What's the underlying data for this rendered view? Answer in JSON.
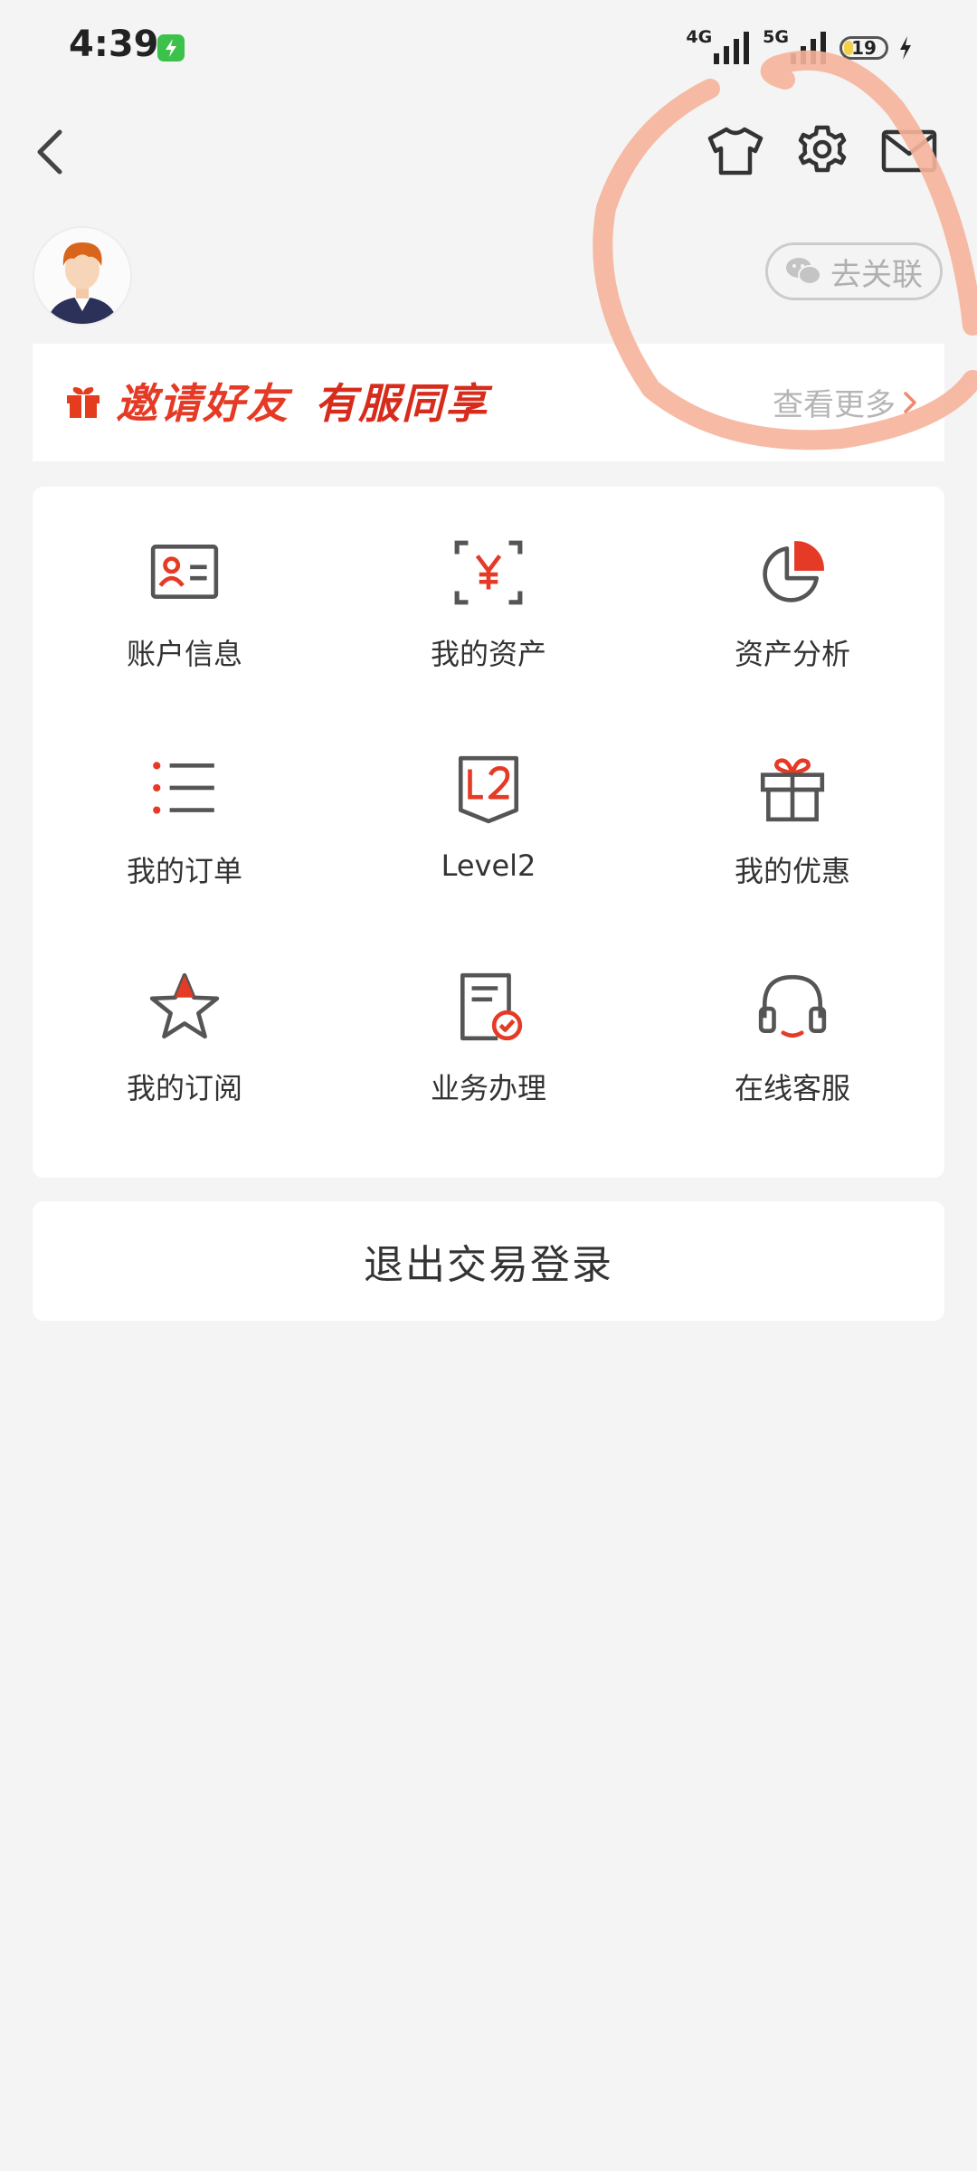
{
  "status_bar": {
    "time": "4:39",
    "network_1": "4G",
    "network_2": "5G",
    "battery": "19"
  },
  "header": {
    "back_icon": "chevron-left-icon",
    "icons": [
      "tshirt-icon",
      "gear-icon",
      "mail-icon"
    ]
  },
  "profile": {
    "wechat_link_label": "去关联"
  },
  "invite_banner": {
    "text": "邀请好友",
    "highlight": "有服同享",
    "more_label": "查看更多"
  },
  "menu": {
    "items": [
      {
        "label": "账户信息",
        "icon": "account-card-icon"
      },
      {
        "label": "我的资产",
        "icon": "yuan-scan-icon"
      },
      {
        "label": "资产分析",
        "icon": "pie-chart-icon"
      },
      {
        "label": "我的订单",
        "icon": "list-icon"
      },
      {
        "label": "Level2",
        "icon": "level2-icon"
      },
      {
        "label": "我的优惠",
        "icon": "gift-icon"
      },
      {
        "label": "我的订阅",
        "icon": "star-icon"
      },
      {
        "label": "业务办理",
        "icon": "document-check-icon"
      },
      {
        "label": "在线客服",
        "icon": "headset-icon"
      }
    ]
  },
  "logout": {
    "label": "退出交易登录"
  },
  "colors": {
    "accent": "#e53a25",
    "background": "#f4f4f4",
    "icon_gray": "#555555"
  }
}
